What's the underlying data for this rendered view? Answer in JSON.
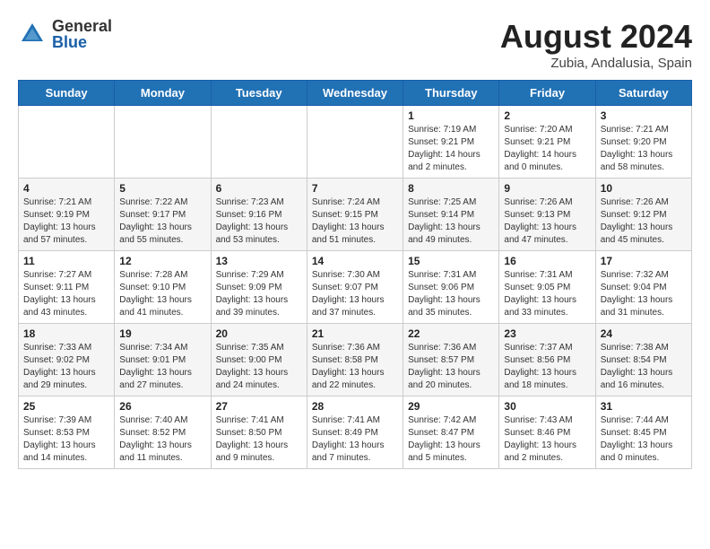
{
  "header": {
    "logo_general": "General",
    "logo_blue": "Blue",
    "title": "August 2024",
    "location": "Zubia, Andalusia, Spain"
  },
  "weekdays": [
    "Sunday",
    "Monday",
    "Tuesday",
    "Wednesday",
    "Thursday",
    "Friday",
    "Saturday"
  ],
  "weeks": [
    [
      {
        "day": "",
        "info": ""
      },
      {
        "day": "",
        "info": ""
      },
      {
        "day": "",
        "info": ""
      },
      {
        "day": "",
        "info": ""
      },
      {
        "day": "1",
        "info": "Sunrise: 7:19 AM\nSunset: 9:21 PM\nDaylight: 14 hours\nand 2 minutes."
      },
      {
        "day": "2",
        "info": "Sunrise: 7:20 AM\nSunset: 9:21 PM\nDaylight: 14 hours\nand 0 minutes."
      },
      {
        "day": "3",
        "info": "Sunrise: 7:21 AM\nSunset: 9:20 PM\nDaylight: 13 hours\nand 58 minutes."
      }
    ],
    [
      {
        "day": "4",
        "info": "Sunrise: 7:21 AM\nSunset: 9:19 PM\nDaylight: 13 hours\nand 57 minutes."
      },
      {
        "day": "5",
        "info": "Sunrise: 7:22 AM\nSunset: 9:17 PM\nDaylight: 13 hours\nand 55 minutes."
      },
      {
        "day": "6",
        "info": "Sunrise: 7:23 AM\nSunset: 9:16 PM\nDaylight: 13 hours\nand 53 minutes."
      },
      {
        "day": "7",
        "info": "Sunrise: 7:24 AM\nSunset: 9:15 PM\nDaylight: 13 hours\nand 51 minutes."
      },
      {
        "day": "8",
        "info": "Sunrise: 7:25 AM\nSunset: 9:14 PM\nDaylight: 13 hours\nand 49 minutes."
      },
      {
        "day": "9",
        "info": "Sunrise: 7:26 AM\nSunset: 9:13 PM\nDaylight: 13 hours\nand 47 minutes."
      },
      {
        "day": "10",
        "info": "Sunrise: 7:26 AM\nSunset: 9:12 PM\nDaylight: 13 hours\nand 45 minutes."
      }
    ],
    [
      {
        "day": "11",
        "info": "Sunrise: 7:27 AM\nSunset: 9:11 PM\nDaylight: 13 hours\nand 43 minutes."
      },
      {
        "day": "12",
        "info": "Sunrise: 7:28 AM\nSunset: 9:10 PM\nDaylight: 13 hours\nand 41 minutes."
      },
      {
        "day": "13",
        "info": "Sunrise: 7:29 AM\nSunset: 9:09 PM\nDaylight: 13 hours\nand 39 minutes."
      },
      {
        "day": "14",
        "info": "Sunrise: 7:30 AM\nSunset: 9:07 PM\nDaylight: 13 hours\nand 37 minutes."
      },
      {
        "day": "15",
        "info": "Sunrise: 7:31 AM\nSunset: 9:06 PM\nDaylight: 13 hours\nand 35 minutes."
      },
      {
        "day": "16",
        "info": "Sunrise: 7:31 AM\nSunset: 9:05 PM\nDaylight: 13 hours\nand 33 minutes."
      },
      {
        "day": "17",
        "info": "Sunrise: 7:32 AM\nSunset: 9:04 PM\nDaylight: 13 hours\nand 31 minutes."
      }
    ],
    [
      {
        "day": "18",
        "info": "Sunrise: 7:33 AM\nSunset: 9:02 PM\nDaylight: 13 hours\nand 29 minutes."
      },
      {
        "day": "19",
        "info": "Sunrise: 7:34 AM\nSunset: 9:01 PM\nDaylight: 13 hours\nand 27 minutes."
      },
      {
        "day": "20",
        "info": "Sunrise: 7:35 AM\nSunset: 9:00 PM\nDaylight: 13 hours\nand 24 minutes."
      },
      {
        "day": "21",
        "info": "Sunrise: 7:36 AM\nSunset: 8:58 PM\nDaylight: 13 hours\nand 22 minutes."
      },
      {
        "day": "22",
        "info": "Sunrise: 7:36 AM\nSunset: 8:57 PM\nDaylight: 13 hours\nand 20 minutes."
      },
      {
        "day": "23",
        "info": "Sunrise: 7:37 AM\nSunset: 8:56 PM\nDaylight: 13 hours\nand 18 minutes."
      },
      {
        "day": "24",
        "info": "Sunrise: 7:38 AM\nSunset: 8:54 PM\nDaylight: 13 hours\nand 16 minutes."
      }
    ],
    [
      {
        "day": "25",
        "info": "Sunrise: 7:39 AM\nSunset: 8:53 PM\nDaylight: 13 hours\nand 14 minutes."
      },
      {
        "day": "26",
        "info": "Sunrise: 7:40 AM\nSunset: 8:52 PM\nDaylight: 13 hours\nand 11 minutes."
      },
      {
        "day": "27",
        "info": "Sunrise: 7:41 AM\nSunset: 8:50 PM\nDaylight: 13 hours\nand 9 minutes."
      },
      {
        "day": "28",
        "info": "Sunrise: 7:41 AM\nSunset: 8:49 PM\nDaylight: 13 hours\nand 7 minutes."
      },
      {
        "day": "29",
        "info": "Sunrise: 7:42 AM\nSunset: 8:47 PM\nDaylight: 13 hours\nand 5 minutes."
      },
      {
        "day": "30",
        "info": "Sunrise: 7:43 AM\nSunset: 8:46 PM\nDaylight: 13 hours\nand 2 minutes."
      },
      {
        "day": "31",
        "info": "Sunrise: 7:44 AM\nSunset: 8:45 PM\nDaylight: 13 hours\nand 0 minutes."
      }
    ]
  ]
}
